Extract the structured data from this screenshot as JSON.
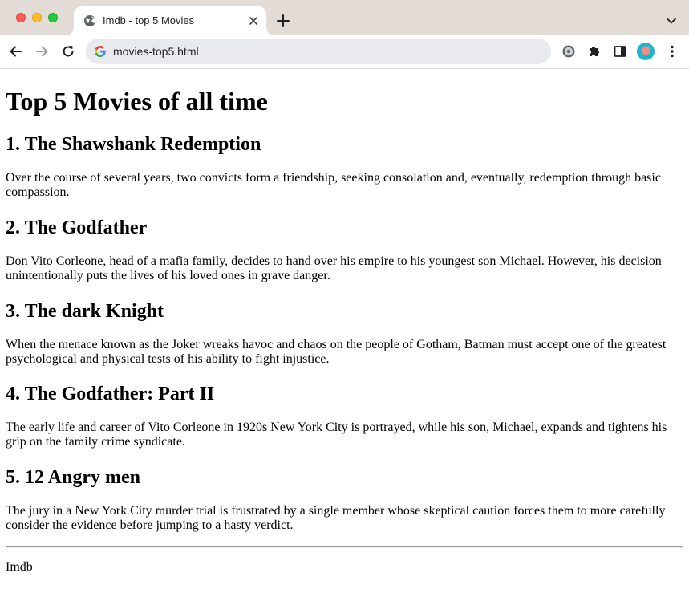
{
  "browser": {
    "tab_title": "Imdb - top 5 Movies",
    "url": "movies-top5.html"
  },
  "page": {
    "title": "Top 5 Movies of all time",
    "movies": [
      {
        "title": "1. The Shawshank Redemption",
        "description": "Over the course of several years, two convicts form a friendship, seeking consolation and, eventually, redemption through basic compassion."
      },
      {
        "title": "2. The Godfather",
        "description": "Don Vito Corleone, head of a mafia family, decides to hand over his empire to his youngest son Michael. However, his decision unintentionally puts the lives of his loved ones in grave danger."
      },
      {
        "title": "3. The dark Knight",
        "description": "When the menace known as the Joker wreaks havoc and chaos on the people of Gotham, Batman must accept one of the greatest psychological and physical tests of his ability to fight injustice."
      },
      {
        "title": "4. The Godfather: Part II",
        "description": "The early life and career of Vito Corleone in 1920s New York City is portrayed, while his son, Michael, expands and tightens his grip on the family crime syndicate."
      },
      {
        "title": "5. 12 Angry men",
        "description": "The jury in a New York City murder trial is frustrated by a single member whose skeptical caution forces them to more carefully consider the evidence before jumping to a hasty verdict."
      }
    ],
    "footer": "Imdb"
  },
  "icons": {
    "tab_favicon": "globe-icon",
    "tab_close": "close-icon",
    "new_tab": "plus-icon",
    "tab_search": "chevron-down-icon",
    "back": "arrow-left-icon",
    "forward": "arrow-right-icon",
    "reload": "reload-icon",
    "omnibox": "google-g-icon",
    "extension_gear": "gear-icon",
    "extensions": "puzzle-icon",
    "side_panel": "side-panel-icon",
    "menu": "kebab-menu-icon"
  },
  "colors": {
    "tabbar_bg": "#e3dbd6",
    "omnibox_bg": "#e8eaed",
    "page_bg": "#ffffff"
  }
}
